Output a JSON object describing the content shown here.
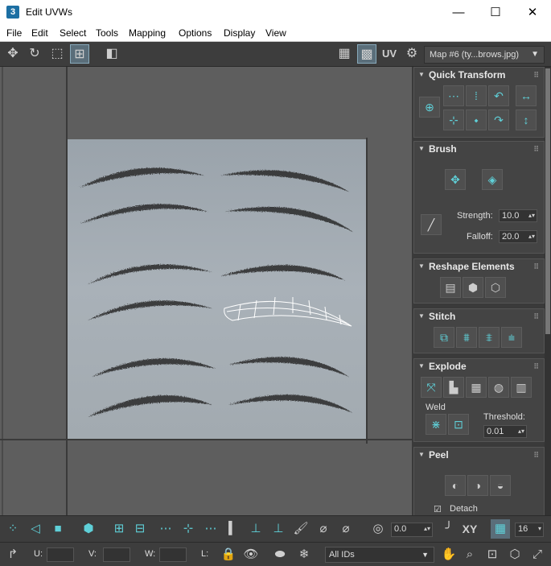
{
  "window": {
    "app_icon": "3",
    "title": "Edit UVWs",
    "minimize": "—",
    "maximize": "☐",
    "close": "✕"
  },
  "menu": [
    "File",
    "Edit",
    "Select",
    "Tools",
    "Mapping",
    "Options",
    "Display",
    "View"
  ],
  "toolbar": {
    "uv_label": "UV",
    "map_select": "Map #6 (ty...brows.jpg)",
    "map_arrow": "▼"
  },
  "panel": {
    "quick_transform": "Quick Transform",
    "brush": "Brush",
    "strength_label": "Strength:",
    "strength_value": "10.0",
    "falloff_label": "Falloff:",
    "falloff_value": "20.0",
    "reshape": "Reshape Elements",
    "stitch": "Stitch",
    "explode": "Explode",
    "weld_label": "Weld",
    "threshold_label": "Threshold:",
    "threshold_value": "0.01",
    "peel": "Peel",
    "detach_label": "Detach",
    "detach_checked": true
  },
  "bottom": {
    "value_field": "0.0",
    "xy_label": "XY",
    "grid_value": "16",
    "u_label": "U:",
    "v_label": "V:",
    "w_label": "W:",
    "l_label": "L:",
    "ids_select": "All IDs",
    "ids_arrow": "▼"
  },
  "colors": {
    "accent": "#5fd0d8",
    "panel_bg": "#3a3a3a",
    "viewport_bg": "#5e5e5e"
  }
}
